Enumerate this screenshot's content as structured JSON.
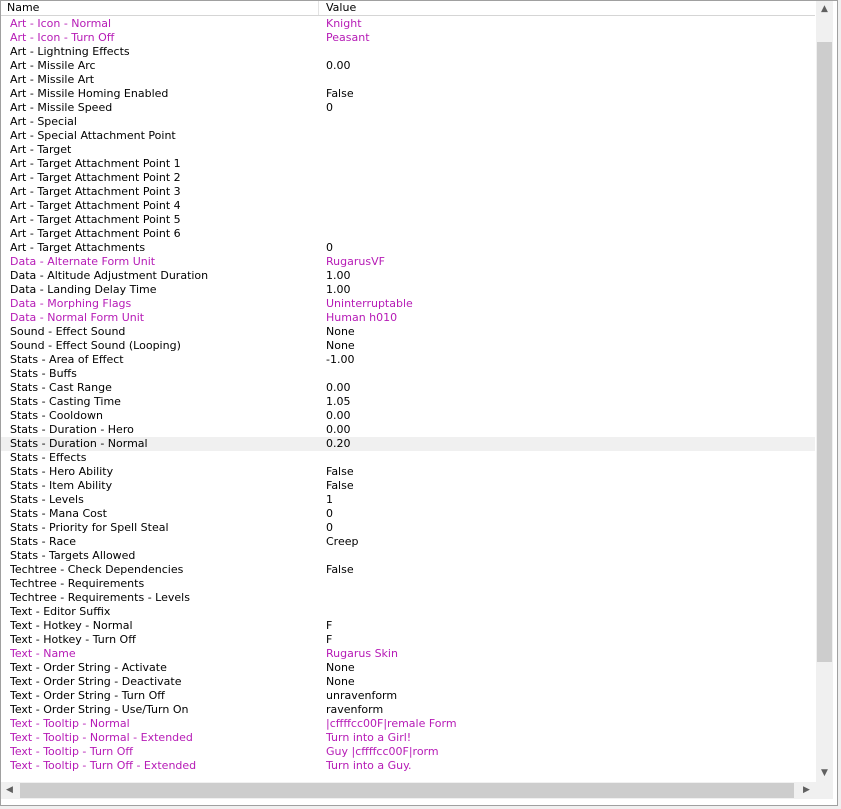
{
  "header": {
    "name": "Name",
    "value": "Value"
  },
  "rows": [
    {
      "name": "Art - Icon - Normal",
      "value": "Knight",
      "modified": true
    },
    {
      "name": "Art - Icon - Turn Off",
      "value": "Peasant",
      "modified": true
    },
    {
      "name": "Art - Lightning Effects",
      "value": "",
      "modified": false
    },
    {
      "name": "Art - Missile Arc",
      "value": "0.00",
      "modified": false
    },
    {
      "name": "Art - Missile Art",
      "value": "",
      "modified": false
    },
    {
      "name": "Art - Missile Homing Enabled",
      "value": "False",
      "modified": false
    },
    {
      "name": "Art - Missile Speed",
      "value": "0",
      "modified": false
    },
    {
      "name": "Art - Special",
      "value": "",
      "modified": false
    },
    {
      "name": "Art - Special Attachment Point",
      "value": "",
      "modified": false
    },
    {
      "name": "Art - Target",
      "value": "",
      "modified": false
    },
    {
      "name": "Art - Target Attachment Point 1",
      "value": "",
      "modified": false
    },
    {
      "name": "Art - Target Attachment Point 2",
      "value": "",
      "modified": false
    },
    {
      "name": "Art - Target Attachment Point 3",
      "value": "",
      "modified": false
    },
    {
      "name": "Art - Target Attachment Point 4",
      "value": "",
      "modified": false
    },
    {
      "name": "Art - Target Attachment Point 5",
      "value": "",
      "modified": false
    },
    {
      "name": "Art - Target Attachment Point 6",
      "value": "",
      "modified": false
    },
    {
      "name": "Art - Target Attachments",
      "value": "0",
      "modified": false
    },
    {
      "name": "Data - Alternate Form Unit",
      "value": "RugarusVF",
      "modified": true
    },
    {
      "name": "Data - Altitude Adjustment Duration",
      "value": "1.00",
      "modified": false
    },
    {
      "name": "Data - Landing Delay Time",
      "value": "1.00",
      "modified": false
    },
    {
      "name": "Data - Morphing Flags",
      "value": "Uninterruptable",
      "modified": true
    },
    {
      "name": "Data - Normal Form Unit",
      "value": "Human h010",
      "modified": true
    },
    {
      "name": "Sound - Effect Sound",
      "value": "None",
      "modified": false
    },
    {
      "name": "Sound - Effect Sound (Looping)",
      "value": "None",
      "modified": false
    },
    {
      "name": "Stats - Area of Effect",
      "value": "-1.00",
      "modified": false
    },
    {
      "name": "Stats - Buffs",
      "value": "",
      "modified": false
    },
    {
      "name": "Stats - Cast Range",
      "value": "0.00",
      "modified": false
    },
    {
      "name": "Stats - Casting Time",
      "value": "1.05",
      "modified": false
    },
    {
      "name": "Stats - Cooldown",
      "value": "0.00",
      "modified": false
    },
    {
      "name": "Stats - Duration - Hero",
      "value": "0.00",
      "modified": false
    },
    {
      "name": "Stats - Duration - Normal",
      "value": "0.20",
      "modified": false,
      "selected": true
    },
    {
      "name": "Stats - Effects",
      "value": "",
      "modified": false
    },
    {
      "name": "Stats - Hero Ability",
      "value": "False",
      "modified": false
    },
    {
      "name": "Stats - Item Ability",
      "value": "False",
      "modified": false
    },
    {
      "name": "Stats - Levels",
      "value": "1",
      "modified": false
    },
    {
      "name": "Stats - Mana Cost",
      "value": "0",
      "modified": false
    },
    {
      "name": "Stats - Priority for Spell Steal",
      "value": "0",
      "modified": false
    },
    {
      "name": "Stats - Race",
      "value": "Creep",
      "modified": false
    },
    {
      "name": "Stats - Targets Allowed",
      "value": "",
      "modified": false
    },
    {
      "name": "Techtree - Check Dependencies",
      "value": "False",
      "modified": false
    },
    {
      "name": "Techtree - Requirements",
      "value": "",
      "modified": false
    },
    {
      "name": "Techtree - Requirements - Levels",
      "value": "",
      "modified": false
    },
    {
      "name": "Text - Editor Suffix",
      "value": "",
      "modified": false
    },
    {
      "name": "Text - Hotkey - Normal",
      "value": "F",
      "modified": false
    },
    {
      "name": "Text - Hotkey - Turn Off",
      "value": "F",
      "modified": false
    },
    {
      "name": "Text - Name",
      "value": "Rugarus Skin",
      "modified": true
    },
    {
      "name": "Text - Order String - Activate",
      "value": "None",
      "modified": false
    },
    {
      "name": "Text - Order String - Deactivate",
      "value": "None",
      "modified": false
    },
    {
      "name": "Text - Order String - Turn Off",
      "value": "unravenform",
      "modified": false
    },
    {
      "name": "Text - Order String - Use/Turn On",
      "value": "ravenform",
      "modified": false
    },
    {
      "name": "Text - Tooltip - Normal",
      "value": "|cffffcc00F|remale Form",
      "modified": true
    },
    {
      "name": "Text - Tooltip - Normal - Extended",
      "value": "Turn into a Girl!",
      "modified": true
    },
    {
      "name": "Text - Tooltip - Turn Off",
      "value": "Guy |cffffcc00F|rorm",
      "modified": true
    },
    {
      "name": "Text - Tooltip - Turn Off - Extended",
      "value": "Turn into a Guy.",
      "modified": true
    }
  ],
  "scrollbars": {
    "vertical_position": 0.19,
    "horizontal_position": 0.0,
    "up_icon": "triangle-up-icon",
    "down_icon": "triangle-down-icon",
    "left_icon": "triangle-left-icon",
    "right_icon": "triangle-right-icon"
  },
  "colors": {
    "modified_text": "#b61bb6",
    "normal_text": "#000000",
    "selected_row_bg": "#f0f0f0"
  }
}
